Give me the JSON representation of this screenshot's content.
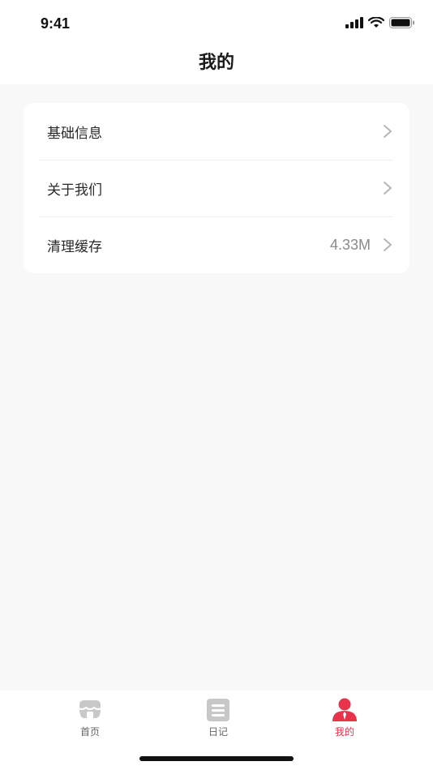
{
  "status_bar": {
    "time": "9:41",
    "icons": [
      "signal-icon",
      "wifi-icon",
      "battery-icon"
    ]
  },
  "nav": {
    "title": "我的"
  },
  "menu": {
    "items": [
      {
        "label": "基础信息",
        "value": "",
        "icon": "chevron-right-icon"
      },
      {
        "label": "关于我们",
        "value": "",
        "icon": "chevron-right-icon"
      },
      {
        "label": "清理缓存",
        "value": "4.33M",
        "icon": "chevron-right-icon"
      }
    ]
  },
  "tabbar": {
    "tabs": [
      {
        "label": "首页",
        "icon": "home-shop-icon",
        "active": false
      },
      {
        "label": "日记",
        "icon": "diary-icon",
        "active": false
      },
      {
        "label": "我的",
        "icon": "profile-icon",
        "active": true
      }
    ]
  },
  "colors": {
    "accent": "#e8334a",
    "background": "#f8f8f8",
    "card": "#ffffff",
    "inactive_icon": "#c8c8c8"
  }
}
